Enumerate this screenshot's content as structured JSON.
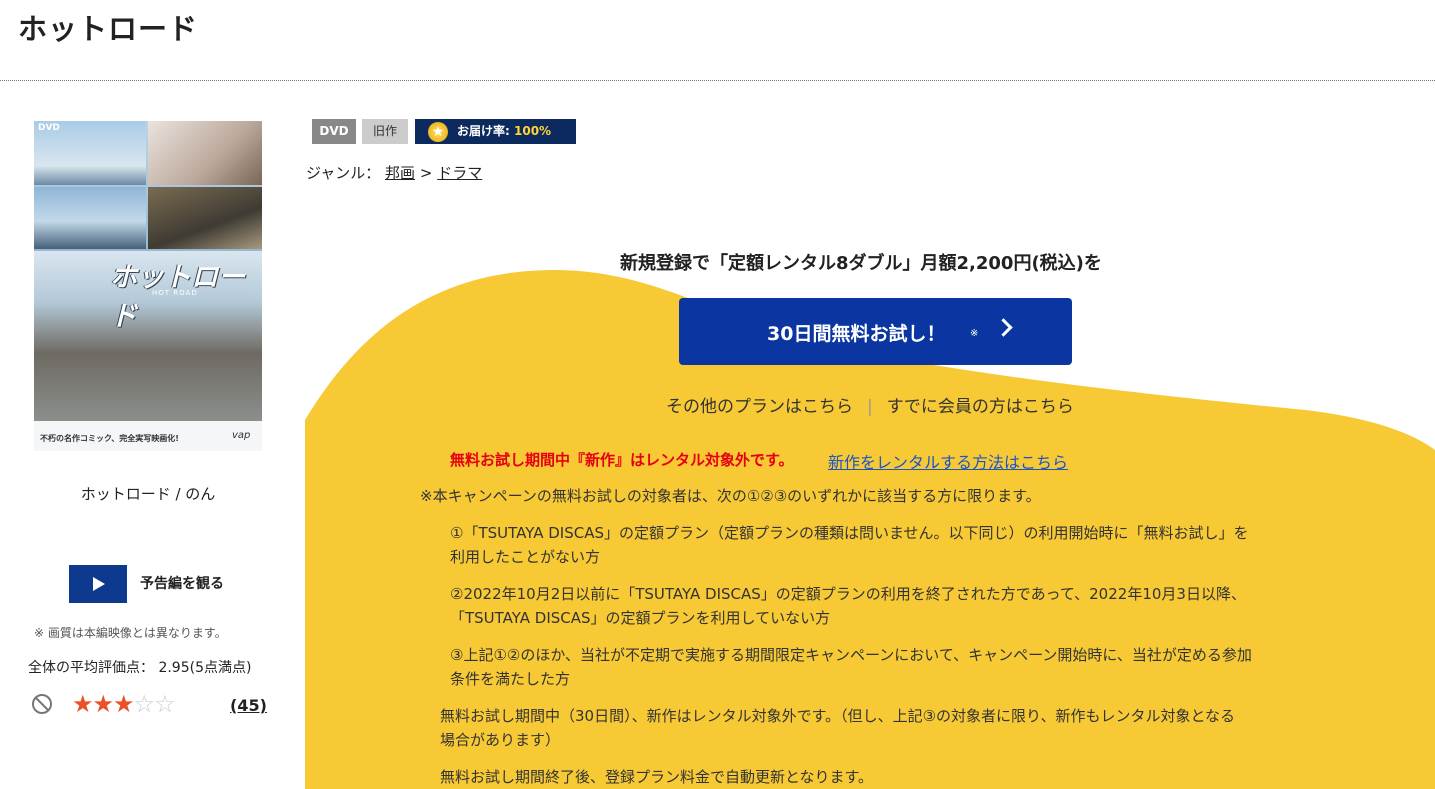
{
  "page": {
    "title": "ホットロード"
  },
  "cover": {
    "dvd_mark": "DVD",
    "logo": "ホットロード",
    "logo_sub": "HOT ROAD",
    "tagline": "不朽の名作コミック、完全実写映画化!",
    "label": "vap"
  },
  "work": {
    "name": "ホットロード / のん"
  },
  "trailer": {
    "label": "予告編を観る"
  },
  "note": "※ 画質は本編映像とは異なります。",
  "rating": {
    "average_text": "全体の平均評価点： 2.95(5点満点)",
    "average": 2.95,
    "max": 5,
    "filled_stars": 3,
    "count": "(45)"
  },
  "tags": {
    "format": "DVD",
    "category": "旧作",
    "delivery_label": "お届け率:",
    "delivery_value": "100%"
  },
  "genre": {
    "label": "ジャンル：",
    "level1": "邦画",
    "sep": ">",
    "level2": "ドラマ"
  },
  "campaign": {
    "headline": "新規登録で「定額レンタル8ダブル」月額2,200円(税込)を",
    "button_label": "30日間無料お試し！",
    "button_mark": "※",
    "other_plans": "その他のプランはこちら",
    "separator": "|",
    "member_login": "すでに会員の方はこちら",
    "warning": "無料お試し期間中『新作』はレンタル対象外です。",
    "warning_link": "新作をレンタルする方法はこちら",
    "eligibility_intro": "※本キャンペーンの無料お試しの対象者は、次の①②③のいずれかに該当する方に限ります。",
    "cond1_line1": "①「TSUTAYA DISCAS」の定額プラン（定額プランの種類は問いません。以下同じ）の利用開始時に「無料お試し」を",
    "cond1_line2": "利用したことがない方",
    "cond2_line1": "②2022年10月2日以前に「TSUTAYA DISCAS」の定額プランの利用を終了された方であって、2022年10月3日以降、",
    "cond2_line2": "「TSUTAYA DISCAS」の定額プランを利用していない方",
    "cond3_line1": "③上記①②のほか、当社が不定期で実施する期間限定キャンペーンにおいて、キャンペーン開始時に、当社が定める参加",
    "cond3_line2": "条件を満たした方",
    "notice1_line1": "無料お試し期間中（30日間）、新作はレンタル対象外です。（但し、上記③の対象者に限り、新作もレンタル対象となる",
    "notice1_line2": "場合があります）",
    "notice2": "無料お試し期間終了後、登録プラン料金で自動更新となります。"
  },
  "colors": {
    "accent_yellow": "#f7c935",
    "button_blue": "#0b36a1",
    "warning_red": "#e60012",
    "link_blue": "#1d55c4",
    "star": "#e8512a"
  }
}
